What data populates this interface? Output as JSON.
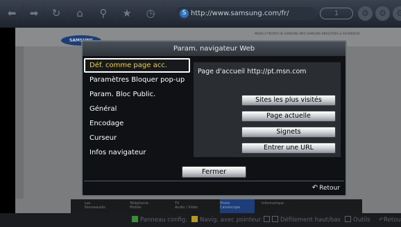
{
  "browser": {
    "url": "http://www.samsung.com/fr/",
    "url_icon": "S",
    "tab_count": "1"
  },
  "webpage": {
    "logo_text": "SAMSUNG",
    "top_links": "MEDIA   A PROPOS DE SAMSUNG   INFO SAMSUNG   INDUSTRIES & REVENDEUR",
    "nav": [
      {
        "line1": "Les",
        "line2": "Nouveautés"
      },
      {
        "line1": "Téléphonie",
        "line2": "Mobile"
      },
      {
        "line1": "TV",
        "line2": "Audio / Vidéo"
      },
      {
        "line1": "Photo",
        "line2": "Caméscope"
      },
      {
        "line1": "Informatique",
        "line2": ""
      }
    ]
  },
  "dialog": {
    "title": "Param. navigateur Web",
    "menu": [
      "Déf. comme page acc.",
      "Paramètres Bloquer pop-up",
      "Param. Bloc Public.",
      "Général",
      "Encodage",
      "Curseur",
      "Infos navigateur"
    ],
    "homepage_text": "Page d'accueil http://pt.msn.com",
    "buttons": [
      "Sites les plus visités",
      "Page actuelle",
      "Signets",
      "Entrer une URL"
    ],
    "close_label": "Fermer",
    "back_label": "Retour"
  },
  "help_bar": {
    "panel_config": "Panneau config.",
    "nav_pointer": "Navig. avec pointeur",
    "scroll": "Défilement haut/bas",
    "tools": "Outils",
    "back": "Retour"
  }
}
